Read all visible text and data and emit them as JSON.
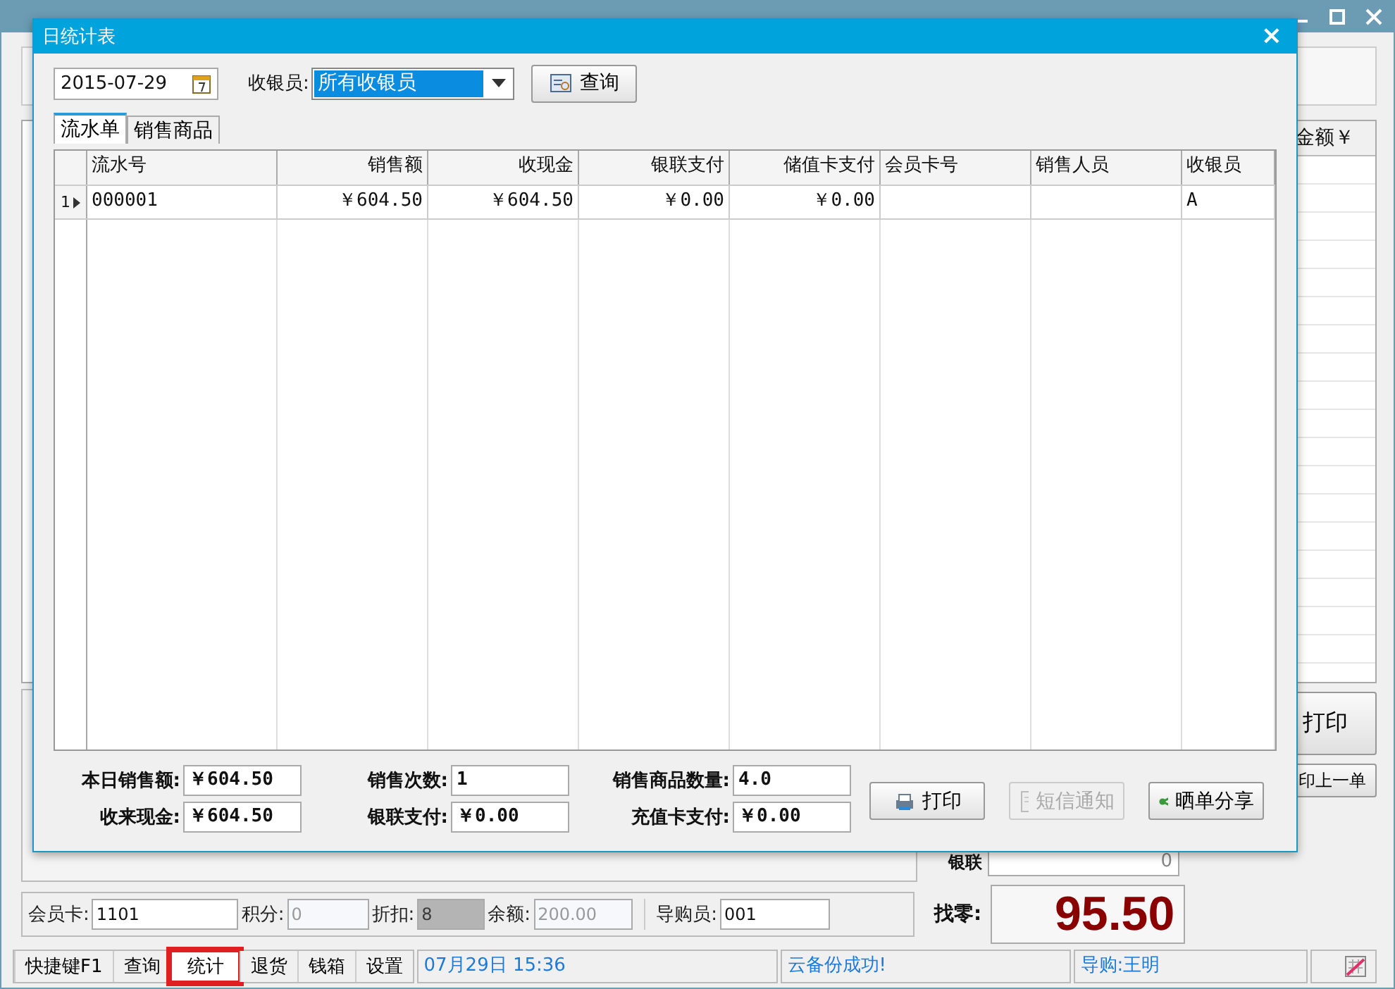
{
  "app": {
    "table": {
      "columns": [
        {
          "label": "金额￥"
        }
      ]
    },
    "buttons": [
      {
        "label": "打印",
        "kind": "large"
      },
      {
        "label": "印上一单",
        "kind": "small"
      }
    ],
    "unionpay": {
      "label": "银联",
      "value": "0"
    },
    "member_bar": [
      {
        "label": "会员卡:",
        "value": "1101",
        "disabled": false,
        "kind": "plain"
      },
      {
        "label": "积分:",
        "value": "0",
        "disabled": true,
        "kind": "plain"
      },
      {
        "label": "折扣:",
        "value": "8",
        "disabled": true,
        "kind": "shaded"
      },
      {
        "label": "余额:",
        "value": "200.00",
        "disabled": true,
        "kind": "plain"
      },
      {
        "label": "导购员:",
        "value": "001",
        "disabled": false,
        "kind": "plain"
      }
    ],
    "change": {
      "label": "找零:",
      "value": "95.50"
    },
    "status_bar": {
      "items": [
        {
          "label": "快捷键F1",
          "selected": false
        },
        {
          "label": "查询",
          "selected": false
        },
        {
          "label": "统计",
          "selected": true
        },
        {
          "label": "退货",
          "selected": false
        },
        {
          "label": "钱箱",
          "selected": false
        },
        {
          "label": "设置",
          "selected": false
        }
      ],
      "datetime": "07月29日 15:36",
      "message": "云备份成功!",
      "guide": "导购:王明"
    }
  },
  "dialog": {
    "title": "日统计表",
    "close": "×",
    "date": "2015-07-29",
    "cashier_label": "收银员:",
    "cashier": "所有收银员",
    "query": "查询",
    "tabs": [
      {
        "label": "流水单",
        "selected": true
      },
      {
        "label": "销售商品",
        "selected": false
      }
    ],
    "table": {
      "columns": [
        {
          "label": "流水号",
          "kind": "text"
        },
        {
          "label": "销售额",
          "kind": "money"
        },
        {
          "label": "收现金",
          "kind": "money"
        },
        {
          "label": "银联支付",
          "kind": "money"
        },
        {
          "label": "储值卡支付",
          "kind": "money"
        },
        {
          "label": "会员卡号",
          "kind": "text"
        },
        {
          "label": "销售人员",
          "kind": "text"
        },
        {
          "label": "收银员",
          "kind": "text"
        }
      ],
      "rows": [
        {
          "index": "1",
          "current": true,
          "cells": [
            "000001",
            "￥604.50",
            "￥604.50",
            "￥0.00",
            "￥0.00",
            "",
            "",
            "A"
          ]
        }
      ]
    },
    "summary": [
      {
        "label": "本日销售额:",
        "value": "￥604.50"
      },
      {
        "label": "销售次数:",
        "value": "1"
      },
      {
        "label": "销售商品数量:",
        "value": "4.0"
      },
      {
        "label": "收来现金:",
        "value": "￥604.50"
      },
      {
        "label": "银联支付:",
        "value": "￥0.00"
      },
      {
        "label": "充值卡支付:",
        "value": "￥0.00"
      }
    ],
    "buttons": [
      {
        "label": "打印",
        "kind": "print",
        "disabled": false
      },
      {
        "label": "短信通知",
        "kind": "sms",
        "disabled": true
      },
      {
        "label": "晒单分享",
        "kind": "share",
        "disabled": false
      }
    ]
  }
}
